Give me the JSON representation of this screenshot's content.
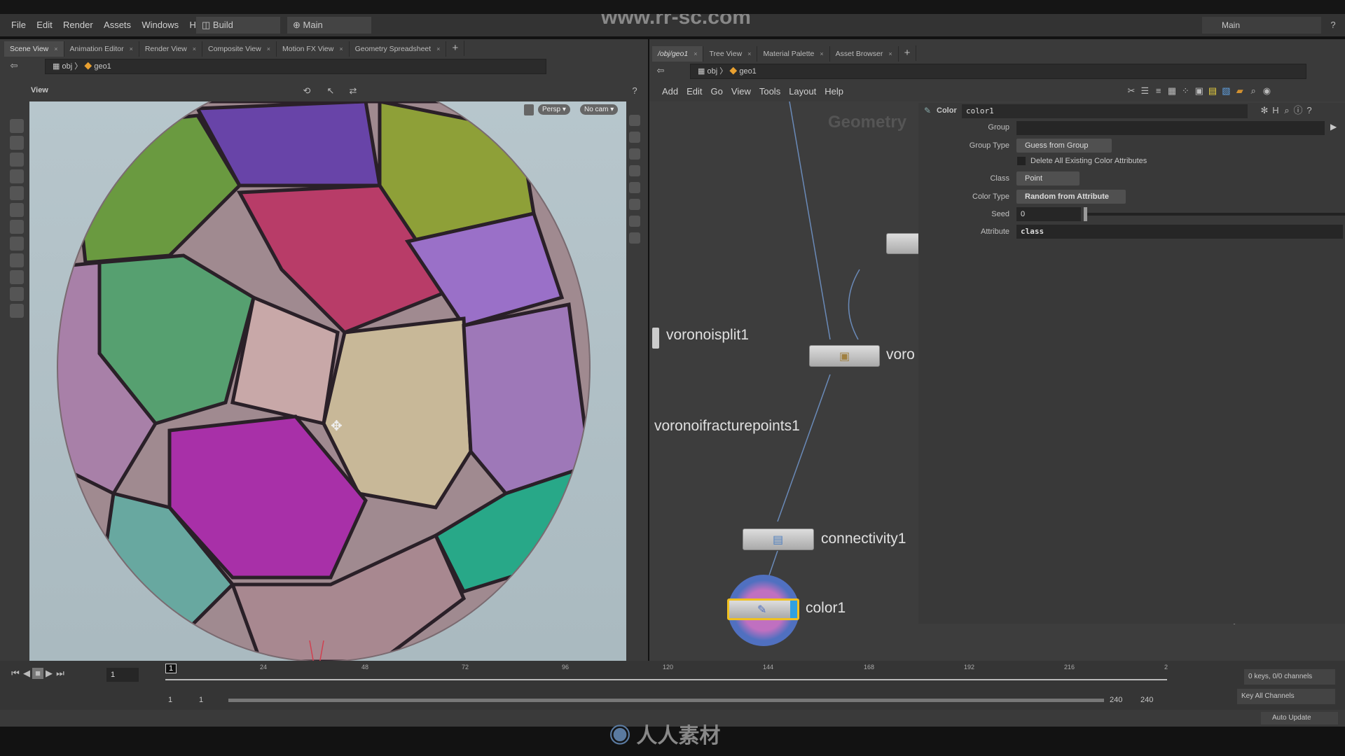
{
  "menubar": {
    "items": [
      "File",
      "Edit",
      "Render",
      "Assets",
      "Windows",
      "Help"
    ],
    "desktop": "Build",
    "context": "Main",
    "right_context": "Main"
  },
  "watermark_top": "www.rr-sc.com",
  "watermark_bottom": "人人素材",
  "left_pane": {
    "tabs": [
      {
        "label": "Scene View",
        "active": true
      },
      {
        "label": "Animation Editor"
      },
      {
        "label": "Render View"
      },
      {
        "label": "Composite View"
      },
      {
        "label": "Motion FX View"
      },
      {
        "label": "Geometry Spreadsheet"
      }
    ],
    "path": [
      "obj",
      "geo1"
    ],
    "view_label": "View",
    "camera": {
      "persp": "Persp ▾",
      "cam": "No cam ▾"
    }
  },
  "right_pane": {
    "tabs": [
      {
        "label": "/obj/geo1",
        "active": true
      },
      {
        "label": "Tree View"
      },
      {
        "label": "Material Palette"
      },
      {
        "label": "Asset Browser"
      }
    ],
    "path": [
      "obj",
      "geo1"
    ],
    "menu": [
      "Add",
      "Edit",
      "Go",
      "View",
      "Tools",
      "Layout",
      "Help"
    ],
    "network_title": "Geometry",
    "nodes": [
      {
        "name": "voronoisplit1"
      },
      {
        "name": "voro"
      },
      {
        "name": "voronoifracturepoints1"
      },
      {
        "name": "connectivity1"
      },
      {
        "name": "color1",
        "selected": true
      }
    ],
    "params": {
      "node_type": "Color",
      "node_name": "color1",
      "group_label": "Group",
      "group_value": "",
      "group_type_label": "Group Type",
      "group_type_value": "Guess from Group",
      "delete_label": "Delete All Existing Color Attributes",
      "delete_checked": false,
      "class_label": "Class",
      "class_value": "Point",
      "color_type_label": "Color Type",
      "color_type_value": "Random from Attribute",
      "seed_label": "Seed",
      "seed_value": "0",
      "attribute_label": "Attribute",
      "attribute_value": "class"
    }
  },
  "timeline": {
    "current_frame": "1",
    "frame_field": "1",
    "ticks": [
      "24",
      "48",
      "72",
      "96",
      "120",
      "144",
      "168",
      "192",
      "216",
      "2"
    ],
    "range_start": "1",
    "range_start2": "1",
    "range_end": "240",
    "range_end2": "240",
    "keys": "0 keys, 0/0 channels",
    "key_all": "Key All Channels"
  },
  "status": {
    "auto_update": "Auto Update"
  },
  "colors": {
    "accent_node": "#f0c020",
    "viewport_bg": "#aebfc6"
  }
}
